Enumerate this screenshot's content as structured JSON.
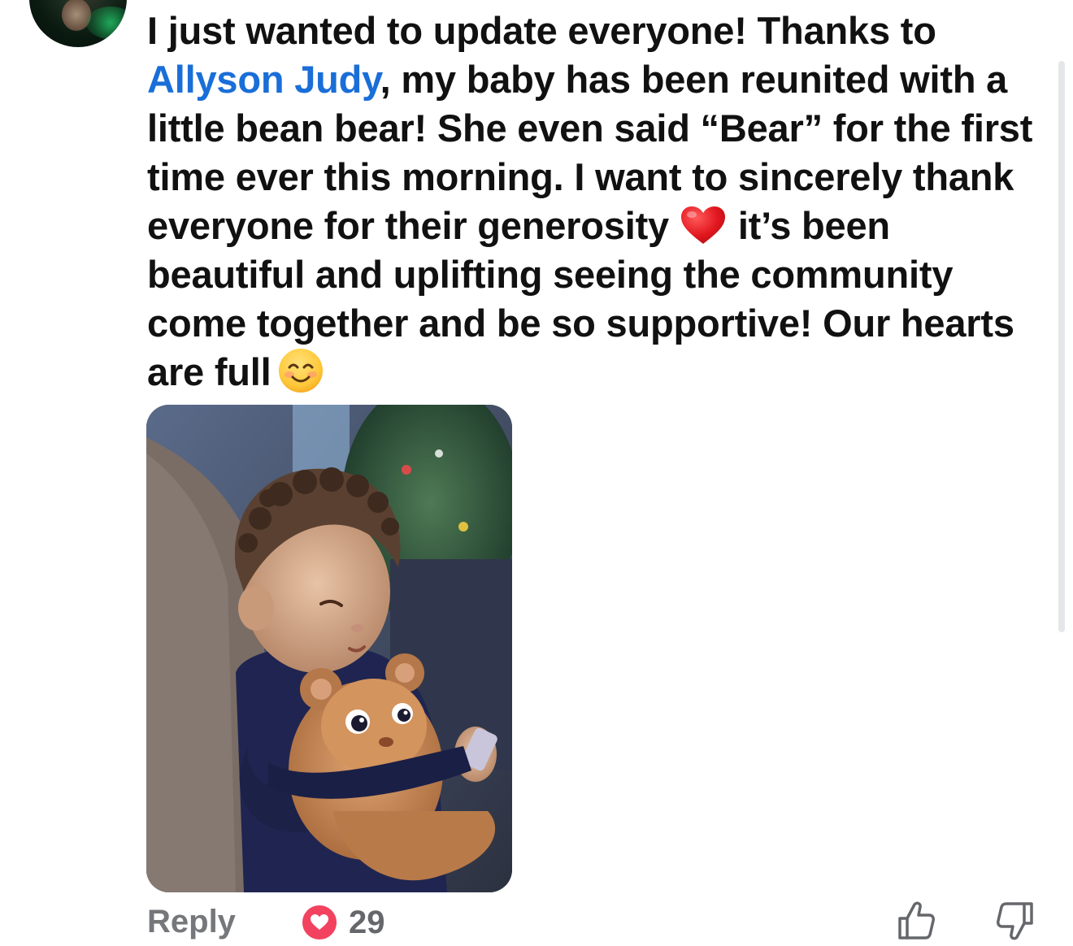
{
  "comment": {
    "text_part_1": "I just wanted to update everyone! Thanks to ",
    "mention": "Allyson Judy",
    "text_part_2": ", my baby has been reunited with a little bean bear! She even said “Bear” for the first time ever this morning. I want to sincerely thank everyone for their generosity ",
    "heart_emoji_icon": "red-heart-icon",
    "text_part_3": "it’s been beautiful and uplifting seeing the community come together and be so supportive! Our hearts are full",
    "smile_emoji_icon": "smiling-face-icon",
    "mention_color": "#1a6ed8"
  },
  "photo": {
    "subject": "toddler-with-teddy-bear"
  },
  "actions": {
    "reply_label": "Reply",
    "reaction_icon": "heart-reaction-icon",
    "reaction_count": "29",
    "reaction_color": "#f3425f",
    "like_icon": "thumbs-up-icon",
    "dislike_icon": "thumbs-down-icon"
  }
}
